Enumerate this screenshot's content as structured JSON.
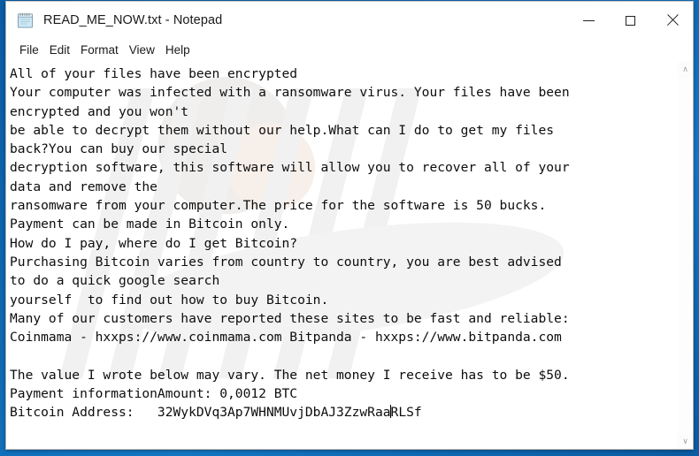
{
  "desktop": {
    "background_color": "#0d64ad"
  },
  "window": {
    "title": "READ_ME_NOW.txt - Notepad",
    "icon": "notepad-icon",
    "controls": {
      "minimize": "Minimize",
      "maximize": "Maximize",
      "close": "Close"
    }
  },
  "menu": {
    "items": [
      {
        "label": "File"
      },
      {
        "label": "Edit"
      },
      {
        "label": "Format"
      },
      {
        "label": "View"
      },
      {
        "label": "Help"
      }
    ]
  },
  "document": {
    "filename": "READ_ME_NOW.txt",
    "lines": [
      "All of your files have been encrypted",
      "Your computer was infected with a ransomware virus. Your files have been",
      "encrypted and you won't",
      "be able to decrypt them without our help.What can I do to get my files",
      "back?You can buy our special",
      "decryption software, this software will allow you to recover all of your",
      "data and remove the",
      "ransomware from your computer.The price for the software is 50 bucks.",
      "Payment can be made in Bitcoin only.",
      "How do I pay, where do I get Bitcoin?",
      "Purchasing Bitcoin varies from country to country, you are best advised",
      "to do a quick google search",
      "yourself  to find out how to buy Bitcoin.",
      "Many of our customers have reported these sites to be fast and reliable:",
      "Coinmama - hxxps://www.coinmama.com Bitpanda - hxxps://www.bitpanda.com",
      "",
      "The value I wrote below may vary. The net money I receive has to be $50.",
      "Payment informationAmount: 0,0012 BTC"
    ],
    "last_line_prefix": "Bitcoin Address:   32WykDVq3Ap7WHNMUvjDbAJ3ZzwRaa",
    "last_line_suffix": "RLSf",
    "caret_present": true,
    "ransom_amount_btc": "0,0012 BTC",
    "ransom_amount_usd": "$50.",
    "price_text": "50 bucks.",
    "bitcoin_address": "32WykDVq3Ap7WHNMUvjDbAJ3ZzwRaaRLSf",
    "exchanges": [
      {
        "name": "Coinmama",
        "url": "hxxps://www.coinmama.com"
      },
      {
        "name": "Bitpanda",
        "url": "hxxps://www.bitpanda.com"
      }
    ]
  },
  "scrollbar": {
    "up_arrow": "∧",
    "down_arrow": "∨",
    "orientation": "vertical"
  }
}
